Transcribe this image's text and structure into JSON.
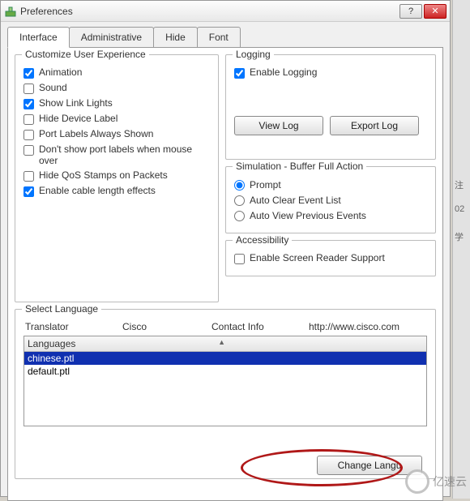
{
  "window": {
    "title": "Preferences"
  },
  "tabs": {
    "t1": "Interface",
    "t2": "Administrative",
    "t3": "Hide",
    "t4": "Font"
  },
  "customize": {
    "title": "Customize User Experience",
    "animation": "Animation",
    "sound": "Sound",
    "link_lights": "Show Link Lights",
    "hide_device_label": "Hide Device Label",
    "port_labels_always": "Port Labels Always Shown",
    "no_port_labels_hover": "Don't show port labels when mouse over",
    "hide_qos": "Hide QoS Stamps on Packets",
    "cable_length": "Enable cable length effects"
  },
  "logging": {
    "title": "Logging",
    "enable": "Enable Logging",
    "view_log": "View Log",
    "export_log": "Export Log"
  },
  "sim": {
    "title": "Simulation - Buffer Full Action",
    "prompt": "Prompt",
    "auto_clear": "Auto Clear Event List",
    "auto_view": "Auto View Previous Events"
  },
  "acc": {
    "title": "Accessibility",
    "reader": "Enable Screen Reader Support"
  },
  "lang": {
    "title": "Select Language",
    "h_translator": "Translator",
    "h_cisco": "Cisco",
    "h_contact": "Contact Info",
    "h_url": "http://www.cisco.com",
    "col_languages": "Languages",
    "items": [
      "chinese.ptl",
      "default.ptl"
    ],
    "change": "Change Langu"
  },
  "watermark": "亿速云"
}
